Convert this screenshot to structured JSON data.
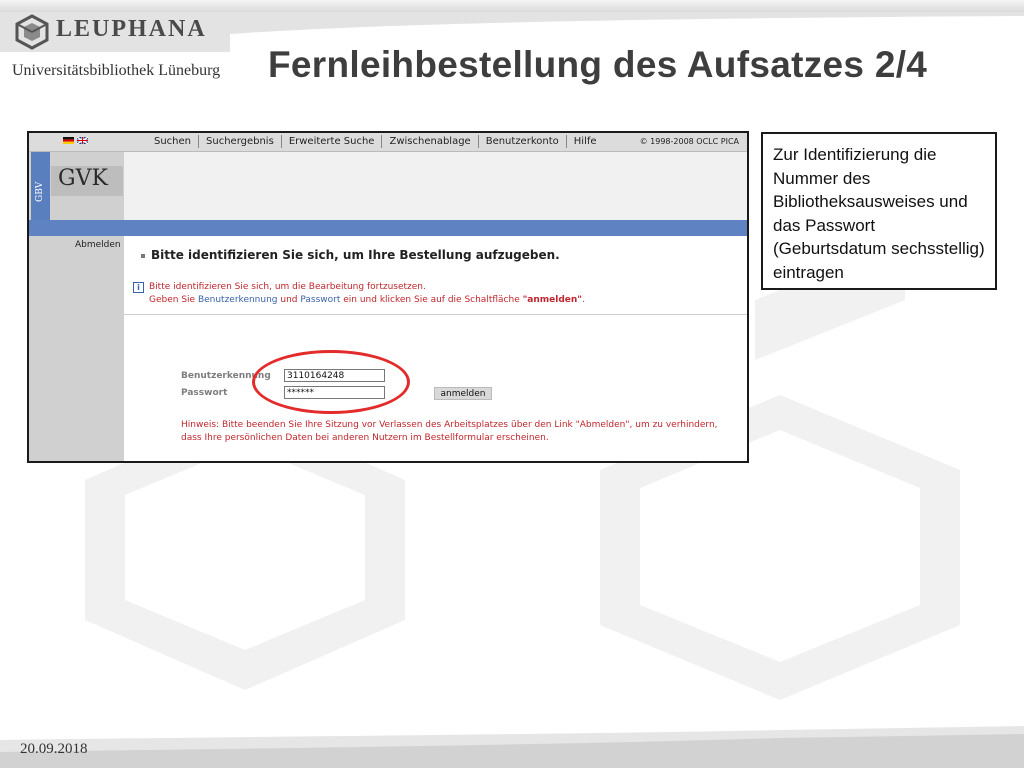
{
  "slide": {
    "logo_text": "LEUPHANA",
    "subtitle": "Universitätsbibliothek Lüneburg",
    "title": "Fernleihbestellung des Aufsatzes 2/4",
    "date": "20.09.2018",
    "callout": "Zur Identifizierung die Nummer des Bibliotheksausweises und das Passwort (Geburtsdatum sechsstellig) eintragen",
    "highlight_color": "#e32b2b"
  },
  "screenshot": {
    "nav": [
      "Suchen",
      "Suchergebnis",
      "Erweiterte Suche",
      "Zwischenablage",
      "Benutzerkonto",
      "Hilfe"
    ],
    "copyright": "© 1998-2008 OCLC PICA",
    "gbv_label": "GBV",
    "gvk_label": "GVK",
    "logout_link": "Abmelden",
    "heading": "Bitte identifizieren Sie sich, um Ihre Bestellung aufzugeben.",
    "message": {
      "line1": "Bitte identifizieren Sie sich, um die Bearbeitung fortzusetzen.",
      "line2_prefix": "Geben Sie ",
      "line2_user": "Benutzerkennung",
      "line2_and": " und ",
      "line2_pass": "Passwort",
      "line2_mid": " ein und klicken Sie auf die Schaltfläche ",
      "line2_button": "\"anmelden\"",
      "line2_end": "."
    },
    "form": {
      "user_label": "Benutzerkennung",
      "user_value": "3110164248",
      "pass_label": "Passwort",
      "pass_value": "******",
      "submit": "anmelden"
    },
    "hint": "Hinweis: Bitte beenden Sie Ihre Sitzung vor Verlassen des Arbeitsplatzes über den Link \"Abmelden\", um zu verhindern, dass Ihre persönlichen Daten bei anderen Nutzern im Bestellformular erscheinen.",
    "colors": {
      "nav_bg": "#dcdcdc",
      "blue_bar": "#5f82c2",
      "error_red": "#c0262d",
      "link_blue": "#3a62a8"
    }
  }
}
